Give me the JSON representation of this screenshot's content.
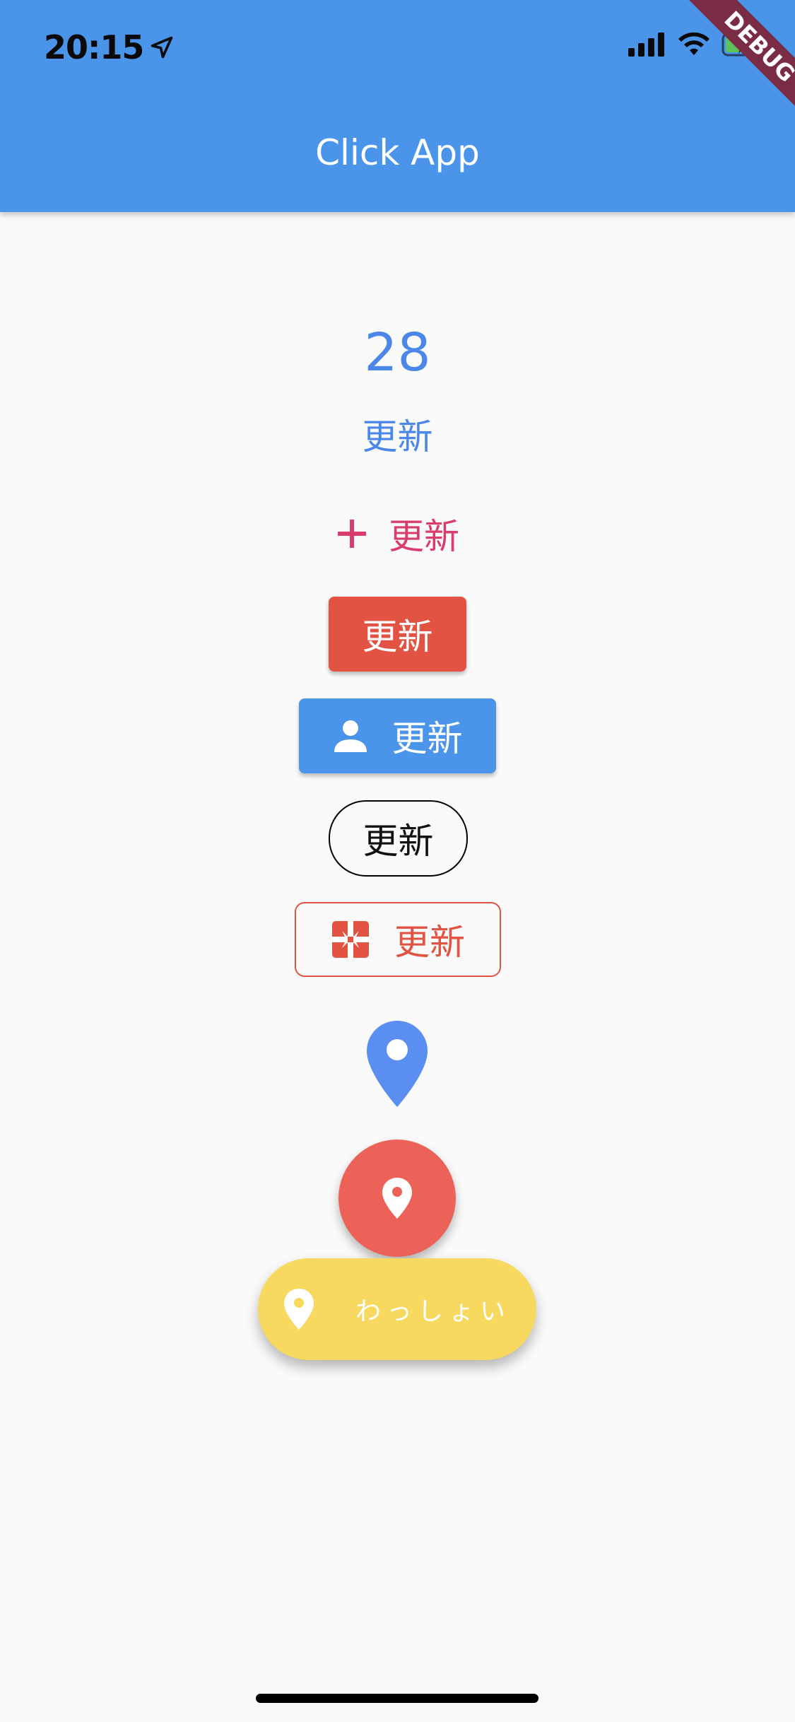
{
  "status_bar": {
    "time": "20:15",
    "location_icon": "location-arrow-icon",
    "signal_icon": "cellular-signal-icon",
    "wifi_icon": "wifi-icon",
    "battery_icon": "battery-charging-icon"
  },
  "app_bar": {
    "title": "Click App",
    "color": "#4a94ea"
  },
  "debug_banner": "DEBUG",
  "counter": {
    "value": "28",
    "color": "#4a87e8"
  },
  "buttons": {
    "text_button": {
      "label": "更新",
      "color": "#4a87e8"
    },
    "icon_text_button": {
      "label": "更新",
      "icon": "plus-icon",
      "color": "#d93d6b"
    },
    "raised_red": {
      "label": "更新",
      "color": "#e25343"
    },
    "raised_blue": {
      "label": "更新",
      "icon": "person-icon",
      "color": "#4a94ea"
    },
    "outline_black": {
      "label": "更新"
    },
    "outline_red": {
      "label": "更新",
      "icon": "gift-box-icon",
      "color": "#e25343"
    },
    "pin_icon_button": {
      "icon": "location-pin-icon",
      "color": "#4a87e8"
    },
    "fab_red": {
      "icon": "location-pin-icon",
      "color": "#ec6258"
    },
    "fab_extended": {
      "label": "わっしょい",
      "icon": "location-pin-icon",
      "color": "#f7d960"
    }
  }
}
